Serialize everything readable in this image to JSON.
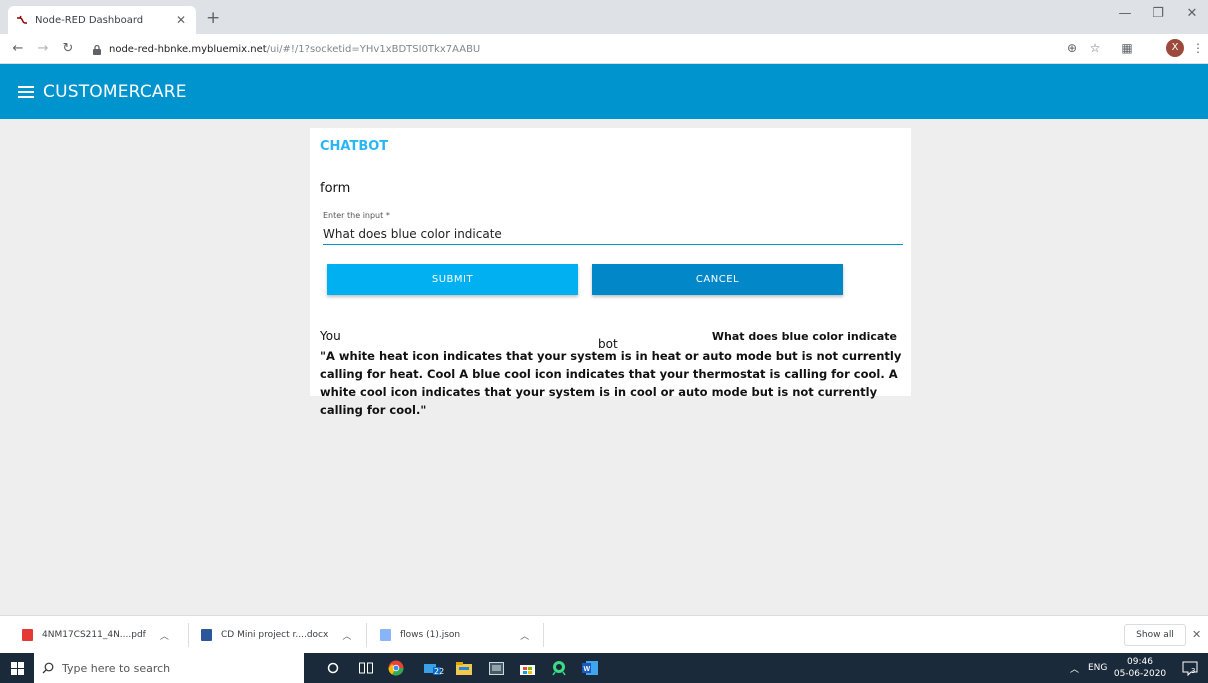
{
  "browser": {
    "tab_title": "Node-RED Dashboard",
    "url_host": "node-red-hbnke.mybluemix.net",
    "url_path": "/ui/#!/1?socketid=YHv1xBDTSI0Tkx7AABU"
  },
  "dashboard": {
    "app_title": "CUSTOMERCARE",
    "card_title": "CHATBOT",
    "form_label": "form",
    "input": {
      "label": "Enter the input",
      "required_mark": "*",
      "value": "What does blue color indicate"
    },
    "submit_label": "SUBMIT",
    "cancel_label": "CANCEL",
    "you_label": "You",
    "bot_label": "bot",
    "user_message": "What does blue color indicate",
    "bot_reply": "\"A white heat icon indicates that your system is in heat or auto mode but is not currently calling for heat. Cool A blue cool icon indicates that your thermostat is calling for cool. A white cool icon indicates that your system is in cool or auto mode but is not currently calling for cool.\""
  },
  "downloads": {
    "items": [
      {
        "name": "4NM17CS211_4N....pdf",
        "icon": "pdf-file-icon"
      },
      {
        "name": "CD Mini project r....docx",
        "icon": "word-file-icon"
      },
      {
        "name": "flows (1).json",
        "icon": "json-file-icon"
      }
    ],
    "show_all": "Show all"
  },
  "taskbar": {
    "search_placeholder": "Type here to search",
    "badge_count": "22",
    "language": "ENG",
    "time": "09:46",
    "date": "05-06-2020",
    "notification_count": "3"
  },
  "colors": {
    "header": "#0094ce",
    "submit": "#00b0f0",
    "cancel": "#0288c9",
    "card_title": "#29b6f6"
  }
}
